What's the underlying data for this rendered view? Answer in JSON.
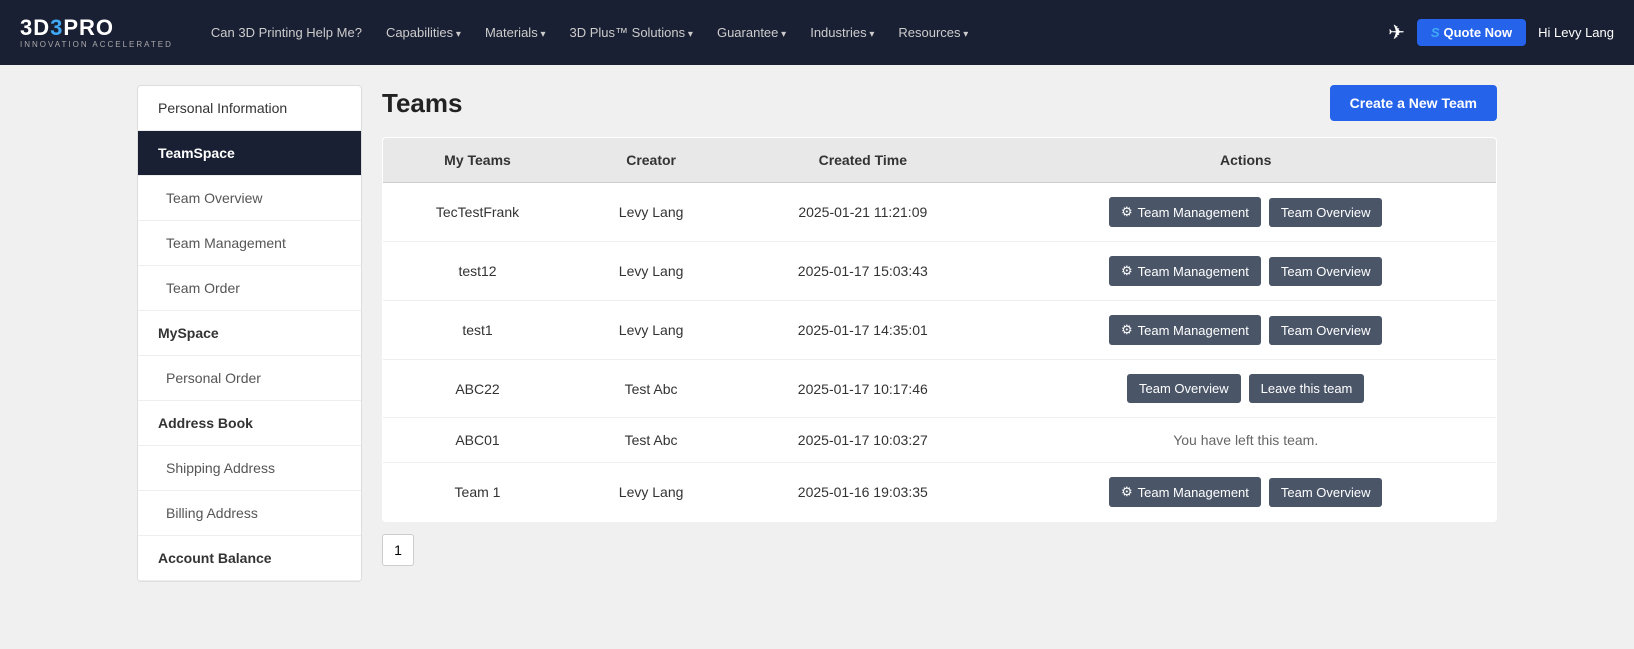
{
  "navbar": {
    "logo_main": "3D3PRO",
    "logo_sub": "INNOVATION ACCELERATED",
    "links": [
      {
        "label": "Can 3D Printing Help Me?",
        "has_arrow": false
      },
      {
        "label": "Capabilities",
        "has_arrow": true
      },
      {
        "label": "Materials",
        "has_arrow": true
      },
      {
        "label": "3D Plus™ Solutions",
        "has_arrow": true
      },
      {
        "label": "Guarantee",
        "has_arrow": true
      },
      {
        "label": "Industries",
        "has_arrow": true
      },
      {
        "label": "Resources",
        "has_arrow": true
      }
    ],
    "quote_btn_label": "Quote Now",
    "quote_btn_s": "S",
    "user_greeting": "Hi Levy Lang"
  },
  "sidebar": {
    "items": [
      {
        "label": "Personal Information",
        "type": "top",
        "active": false
      },
      {
        "label": "TeamSpace",
        "type": "top",
        "active": true
      },
      {
        "label": "Team Overview",
        "type": "sub",
        "active": false
      },
      {
        "label": "Team Management",
        "type": "sub",
        "active": false
      },
      {
        "label": "Team Order",
        "type": "sub",
        "active": false
      },
      {
        "label": "MySpace",
        "type": "section",
        "active": false
      },
      {
        "label": "Personal Order",
        "type": "sub",
        "active": false
      },
      {
        "label": "Address Book",
        "type": "section",
        "active": false
      },
      {
        "label": "Shipping Address",
        "type": "sub",
        "active": false
      },
      {
        "label": "Billing Address",
        "type": "sub",
        "active": false
      },
      {
        "label": "Account Balance",
        "type": "section",
        "active": false
      }
    ]
  },
  "page": {
    "title": "Teams",
    "create_btn": "Create a New Team"
  },
  "table": {
    "headers": [
      "My Teams",
      "Creator",
      "Created Time",
      "Actions"
    ],
    "rows": [
      {
        "team": "TecTestFrank",
        "creator": "Levy Lang",
        "created": "2025-01-21 11:21:09",
        "action_type": "management_overview"
      },
      {
        "team": "test12",
        "creator": "Levy Lang",
        "created": "2025-01-17 15:03:43",
        "action_type": "management_overview"
      },
      {
        "team": "test1",
        "creator": "Levy Lang",
        "created": "2025-01-17 14:35:01",
        "action_type": "management_overview"
      },
      {
        "team": "ABC22",
        "creator": "Test Abc",
        "created": "2025-01-17 10:17:46",
        "action_type": "overview_leave"
      },
      {
        "team": "ABC01",
        "creator": "Test Abc",
        "created": "2025-01-17 10:03:27",
        "action_type": "left_message"
      },
      {
        "team": "Team 1",
        "creator": "Levy Lang",
        "created": "2025-01-16 19:03:35",
        "action_type": "management_overview"
      }
    ],
    "btn_management": "Team Management",
    "btn_overview": "Team Overview",
    "btn_leave": "Leave this team",
    "left_msg": "You have left this team."
  },
  "pagination": {
    "current_page": 1
  }
}
